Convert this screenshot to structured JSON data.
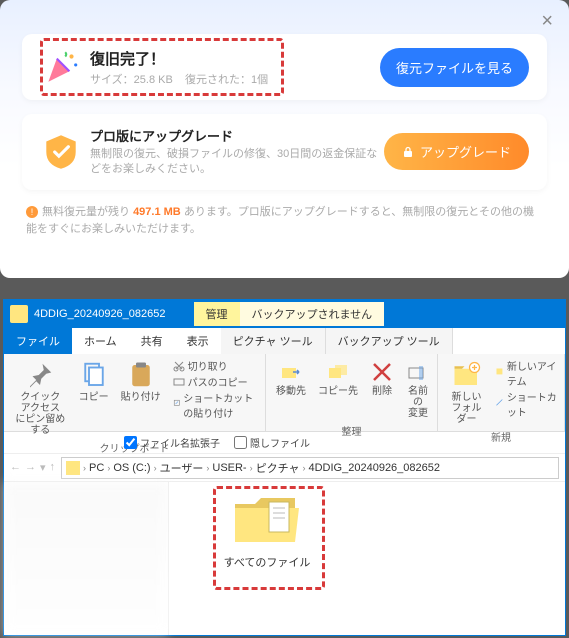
{
  "dialog": {
    "success": {
      "title": "復旧完了！",
      "size_label": "サイズ：",
      "size_value": "25.8 KB",
      "restored_label": "復元された：",
      "restored_count": "1個",
      "view_button": "復元ファイルを見る"
    },
    "upgrade": {
      "title": "プロ版にアップグレード",
      "desc": "無制限の復元、破損ファイルの修復、30日間の返金保証などをお楽しみください。",
      "button": "アップグレード"
    },
    "footnote": {
      "pre": "無料復元量が残り",
      "amount": "497.1 MB",
      "post": "あります。プロ版にアップグレードすると、無制限の復元とその他の機能をすぐにお楽しみいただけます。"
    }
  },
  "explorer": {
    "title": "4DDIG_20240926_082652",
    "context_tabs": {
      "manage": "管理",
      "backup": "バックアップされません"
    },
    "tabs": {
      "file": "ファイル",
      "home": "ホーム",
      "share": "共有",
      "view": "表示",
      "pic_tool": "ピクチャ ツール",
      "backup_tool": "バックアップ ツール"
    },
    "ribbon": {
      "pin": "クイック アクセス\nにピン留めする",
      "copy": "コピー",
      "paste": "貼り付け",
      "cut": "切り取り",
      "copy_path": "パスのコピー",
      "paste_shortcut": "ショートカットの貼り付け",
      "group_clipboard": "クリップボード",
      "move_to": "移動先",
      "copy_to": "コピー先",
      "delete": "削除",
      "rename": "名前の\n変更",
      "group_organize": "整理",
      "new_folder": "新しい\nフォルダー",
      "new_item": "新しいアイテム",
      "shortcut": "ショートカット",
      "group_new": "新規"
    },
    "options": {
      "ext": "ファイル名拡張子",
      "hidden": "隠しファイル"
    },
    "breadcrumbs": [
      "PC",
      "OS (C:)",
      "ユーザー",
      "USER-",
      "ピクチャ",
      "4DDIG_20240926_082652"
    ],
    "folder_label": "すべてのファイル"
  }
}
